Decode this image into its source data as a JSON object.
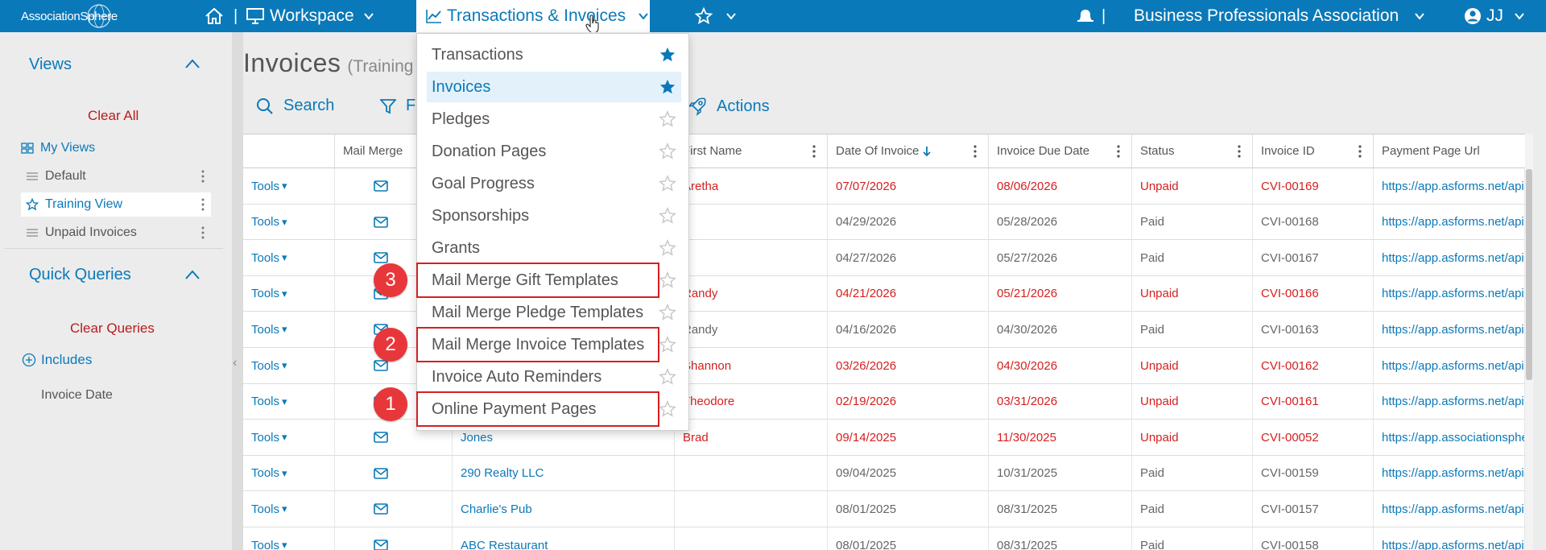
{
  "topbar": {
    "logo_text": "AssociationSphere",
    "workspace_label": "Workspace",
    "active_menu_label": "Transactions & Invoices",
    "org_name": "Business Professionals Association",
    "user_initials": "JJ",
    "separator": "|"
  },
  "sidebar": {
    "views_title": "Views",
    "clear_all": "Clear All",
    "my_views": "My Views",
    "views": [
      {
        "label": "Default"
      },
      {
        "label": "Training View"
      },
      {
        "label": "Unpaid Invoices"
      }
    ],
    "quick_queries_title": "Quick Queries",
    "clear_queries": "Clear Queries",
    "includes_label": "Includes",
    "invoice_date_label": "Invoice Date"
  },
  "main": {
    "page_title": "Invoices",
    "page_subtitle": "(Training",
    "search_label": "Search",
    "filter_label": "F",
    "actions_label": "Actions"
  },
  "dropdown": {
    "items": [
      {
        "label": "Transactions",
        "starred": true
      },
      {
        "label": "Invoices",
        "starred": true,
        "selected": true
      },
      {
        "label": "Pledges",
        "starred": false
      },
      {
        "label": "Donation Pages",
        "starred": false
      },
      {
        "label": "Goal Progress",
        "starred": false
      },
      {
        "label": "Sponsorships",
        "starred": false
      },
      {
        "label": "Grants",
        "starred": false
      },
      {
        "label": "Mail Merge Gift Templates",
        "starred": false
      },
      {
        "label": "Mail Merge Pledge Templates",
        "starred": false
      },
      {
        "label": "Mail Merge Invoice Templates",
        "starred": false
      },
      {
        "label": "Invoice Auto Reminders",
        "starred": false
      },
      {
        "label": "Online Payment Pages",
        "starred": false
      }
    ],
    "callouts": [
      "3",
      "2",
      "1"
    ]
  },
  "table": {
    "headers": {
      "mail_merge": "Mail Merge",
      "first_name": "First Name",
      "date_of_invoice": "Date Of Invoice",
      "invoice_due_date": "Invoice Due Date",
      "status": "Status",
      "invoice_id": "Invoice ID",
      "payment_page_url": "Payment Page Url"
    },
    "tools_label": "Tools",
    "rows": [
      {
        "last": "",
        "first": "Aretha",
        "date": "07/07/2026",
        "due": "08/06/2026",
        "status": "Unpaid",
        "id": "CVI-00169",
        "url": "https://app.asforms.net/api",
        "unpaid": true
      },
      {
        "last": "",
        "first": "",
        "date": "04/29/2026",
        "due": "05/28/2026",
        "status": "Paid",
        "id": "CVI-00168",
        "url": "https://app.asforms.net/api",
        "unpaid": false
      },
      {
        "last": "",
        "first": "",
        "date": "04/27/2026",
        "due": "05/27/2026",
        "status": "Paid",
        "id": "CVI-00167",
        "url": "https://app.asforms.net/api",
        "unpaid": false
      },
      {
        "last": "",
        "first": "Randy",
        "date": "04/21/2026",
        "due": "05/21/2026",
        "status": "Unpaid",
        "id": "CVI-00166",
        "url": "https://app.asforms.net/api",
        "unpaid": true
      },
      {
        "last": "",
        "first": "Randy",
        "date": "04/16/2026",
        "due": "04/30/2026",
        "status": "Paid",
        "id": "CVI-00163",
        "url": "https://app.asforms.net/api",
        "unpaid": false
      },
      {
        "last": "",
        "first": "Shannon",
        "date": "03/26/2026",
        "due": "04/30/2026",
        "status": "Unpaid",
        "id": "CVI-00162",
        "url": "https://app.asforms.net/api",
        "unpaid": true
      },
      {
        "last": "",
        "first": "Theodore",
        "date": "02/19/2026",
        "due": "03/31/2026",
        "status": "Unpaid",
        "id": "CVI-00161",
        "url": "https://app.asforms.net/api",
        "unpaid": true
      },
      {
        "last": "Jones",
        "first": "Brad",
        "date": "09/14/2025",
        "due": "11/30/2025",
        "status": "Unpaid",
        "id": "CVI-00052",
        "url": "https://app.associationsphe",
        "unpaid": true
      },
      {
        "last": "290 Realty LLC",
        "first": "",
        "date": "09/04/2025",
        "due": "10/31/2025",
        "status": "Paid",
        "id": "CVI-00159",
        "url": "https://app.asforms.net/api",
        "unpaid": false
      },
      {
        "last": "Charlie's Pub",
        "first": "",
        "date": "08/01/2025",
        "due": "08/31/2025",
        "status": "Paid",
        "id": "CVI-00157",
        "url": "https://app.asforms.net/api",
        "unpaid": false
      },
      {
        "last": "ABC Restaurant",
        "first": "",
        "date": "08/01/2025",
        "due": "08/31/2025",
        "status": "Paid",
        "id": "CVI-00158",
        "url": "https://app.asforms.net/api",
        "unpaid": false
      }
    ]
  },
  "colors": {
    "brand_blue": "#0a79b9",
    "unpaid_red": "#d42020",
    "highlight_red": "#e8373a"
  }
}
